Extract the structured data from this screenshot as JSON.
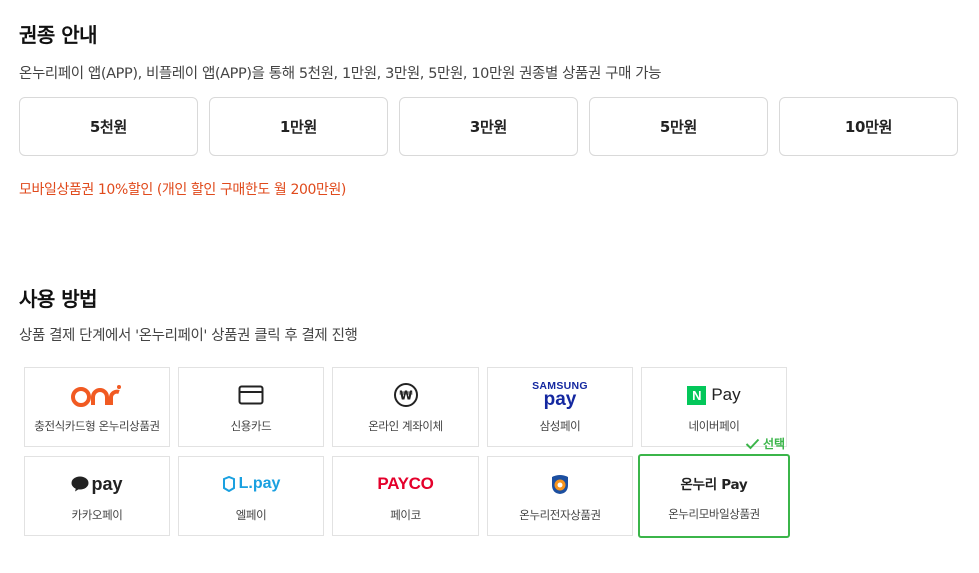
{
  "denomination": {
    "title": "권종 안내",
    "description": "온누리페이 앱(APP), 비플레이 앱(APP)을 통해 5천원, 1만원, 3만원, 5만원, 10만원 권종별 상품권 구매 가능",
    "options": [
      "5천원",
      "1만원",
      "3만원",
      "5만원",
      "10만원"
    ],
    "notice": "모바일상품권 10%할인 (개인 할인 구매한도 월 200만원)"
  },
  "usage": {
    "title": "사용 방법",
    "description": "상품 결제 단계에서 '온누리페이' 상품권 클릭 후 결제 진행",
    "selected_label": "선택",
    "methods": [
      {
        "label": "충전식카드형 온누리상품권",
        "logo": "onnuri-card-icon"
      },
      {
        "label": "신용카드",
        "logo": "credit-card-icon"
      },
      {
        "label": "온라인 계좌이체",
        "logo": "won-coin-icon"
      },
      {
        "label": "삼성페이",
        "logo": "samsung-pay-icon",
        "logo_text_top": "SAMSUNG",
        "logo_text_bottom": "pay"
      },
      {
        "label": "네이버페이",
        "logo": "naver-pay-icon",
        "logo_text": "Pay"
      },
      {
        "label": "카카오페이",
        "logo": "kakao-pay-icon",
        "logo_text": "pay"
      },
      {
        "label": "엘페이",
        "logo": "lpay-icon",
        "logo_text": "L.pay"
      },
      {
        "label": "페이코",
        "logo": "payco-icon",
        "logo_text": "PAYCO"
      },
      {
        "label": "온누리전자상품권",
        "logo": "onnuri-e-voucher-icon"
      },
      {
        "label": "온누리모바일상품권",
        "logo": "onnuri-pay-icon",
        "logo_text": "온누리 Pay"
      }
    ]
  },
  "colors": {
    "notice": "#e04a1c",
    "selected": "#3bb54a",
    "naver_green": "#03c75a",
    "payco_red": "#e4002b",
    "samsung_blue": "#1428a0",
    "lpay_blue": "#1aa0e0",
    "onnuri_orange": "#f15a22"
  }
}
